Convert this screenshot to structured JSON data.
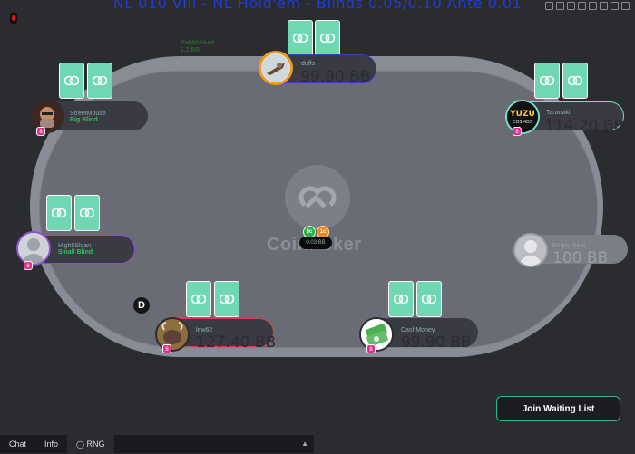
{
  "window": {
    "title": "NL 010 VIII - NL Hold'em - Blinds 0.05/0.10 Ante 0.01"
  },
  "table": {
    "brand": "CoinPoker",
    "pot_amount": "0.03 BB",
    "ghost_line1": "Rabbit Hunt",
    "ghost_line2": "1.2 BB",
    "dealer_button": "D",
    "chip_labels": [
      "5c",
      "1c"
    ]
  },
  "seats": [
    {
      "name": "duffs",
      "stack": "99.90 BB",
      "status": ""
    },
    {
      "name": "StreetMouse",
      "stack": "",
      "status": "Big Blind"
    },
    {
      "name": "Taranaki",
      "stack": "114.20 BB",
      "status": ""
    },
    {
      "name": "High5Sloan",
      "stack": "",
      "status": "Small Blind"
    },
    {
      "name": "Empty Seat",
      "stack": "100 BB",
      "status": ""
    },
    {
      "name": "lew62",
      "stack": "127.40 BB",
      "status": ""
    },
    {
      "name": "CashMoney",
      "stack": "99.90 BB",
      "status": ""
    }
  ],
  "actions": {
    "join_waiting_list": "Join Waiting List"
  },
  "bottom_tabs": [
    "Chat",
    "Info",
    "RNG"
  ],
  "colors": {
    "background": "#2b2c30",
    "table_felt": "#6a6c75",
    "table_rail": "#8a8c95",
    "card_back": "#6fd8b3",
    "accent": "#2bb592",
    "title_blue": "#1f3bd8"
  }
}
